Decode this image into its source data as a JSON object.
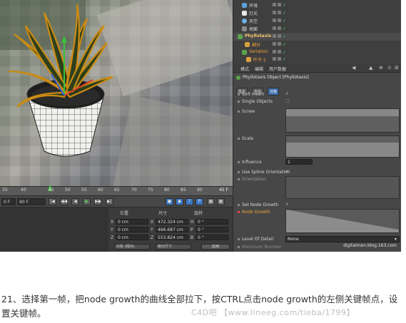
{
  "viewport": {
    "frame_readout": "45 F"
  },
  "timeline": {
    "ticks": [
      "35",
      "40",
      "45",
      "50",
      "55",
      "60",
      "65",
      "70",
      "75",
      "80",
      "85",
      "90"
    ]
  },
  "transport": {
    "start_field": "0 F",
    "end_field": "90 F",
    "buttons": [
      "|◀",
      "◀◀",
      "◀",
      "▶",
      "▶▶",
      "▶|",
      "●",
      "◆",
      "?",
      "P",
      "▦",
      "▦"
    ]
  },
  "coordinates": {
    "headers": {
      "position": "位置",
      "size": "尺寸",
      "rotation": "旋转"
    },
    "rows": [
      {
        "axis": "X",
        "pos": "0 cm",
        "size_axis": "X",
        "size": "472.324 cm",
        "rot_axis": "H",
        "rot": "0 °"
      },
      {
        "axis": "Y",
        "pos": "0 cm",
        "size_axis": "Y",
        "size": "466.687 cm",
        "rot_axis": "P",
        "rot": "0 °"
      },
      {
        "axis": "Z",
        "pos": "0 cm",
        "size_axis": "Z",
        "size": "553.824 cm",
        "rot_axis": "B",
        "rot": "0 °"
      }
    ],
    "mode_dropdown": "对象 (相对)",
    "size_dropdown": "绝对尺寸",
    "apply_button": "应用"
  },
  "object_manager": {
    "items": [
      {
        "name": "环境",
        "indent": 12,
        "color": "#5aa0d8",
        "style": ""
      },
      {
        "name": "灯光",
        "indent": 12,
        "color": "#e8e8e8",
        "style": ""
      },
      {
        "name": "天空",
        "indent": 12,
        "color": "#6ab0e8",
        "style": ""
      },
      {
        "name": "地面",
        "indent": 12,
        "color": "#8a8a8a",
        "style": ""
      },
      {
        "name": "Phyllotaxis",
        "indent": 6,
        "color": "#5ca34d",
        "style": "hl"
      },
      {
        "name": "细分",
        "indent": 16,
        "color": "#d8a040",
        "style": "orange"
      },
      {
        "name": "Variation",
        "indent": 12,
        "color": "#5ca34d",
        "style": "orange"
      },
      {
        "name": "叶子.1",
        "indent": 18,
        "color": "#d8a040",
        "style": "orange"
      }
    ]
  },
  "attribute_manager": {
    "menu": [
      "模式",
      "编辑",
      "用户数据"
    ],
    "object_title": "Phyllotaxis Object [Phyllotaxis]",
    "tabs": [
      "基本",
      "坐标",
      "对象"
    ],
    "properties": {
      "soft_insert": "Soft Insert",
      "single_objects": "Single Objects",
      "screw": "Screw",
      "scale": "Scale",
      "influence": "Influence",
      "influence_value": "1",
      "use_spline_orientation": "Use Spline Orientation",
      "orientation": "Orientation",
      "set_node_growth": "Set Node Growth",
      "node_growth": "Node Growth",
      "level_of_detail": "Level Of Detail",
      "level_of_detail_value": "None",
      "maximum_number": "Maximum Number"
    },
    "check": "✓"
  },
  "watermark": "digitalmen.blog.163.com",
  "caption": "21、选择第一帧，把node growth的曲线全部拉下，按CTRL点击node growth的左侧关键帧点，设置关键帧。",
  "forum_watermark": "C4D吧 【www.lineeg.com/tieba/1799】"
}
